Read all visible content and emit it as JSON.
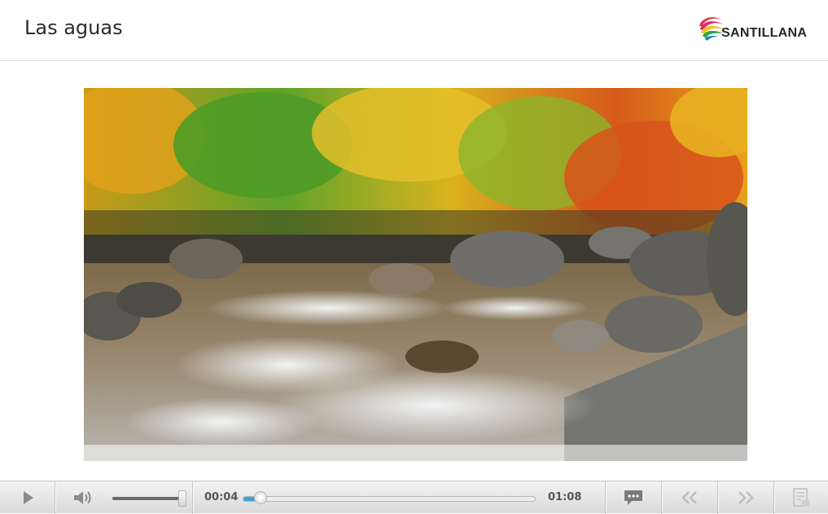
{
  "header": {
    "title": "Las aguas",
    "logo_text": "SANTILLANA"
  },
  "player": {
    "current_time": "00:04",
    "duration": "01:08",
    "progress_fraction": 0.059,
    "volume_fraction": 0.92,
    "icons": [
      "play-icon",
      "volume-icon",
      "subtitles-icon",
      "previous-icon",
      "next-icon",
      "transcript-icon"
    ]
  },
  "colors": {
    "progress": "#3aa3d6",
    "logo_red": "#e8303a",
    "logo_yellow": "#f5c21b",
    "logo_green": "#2aa84a",
    "logo_pink": "#e0287d"
  }
}
